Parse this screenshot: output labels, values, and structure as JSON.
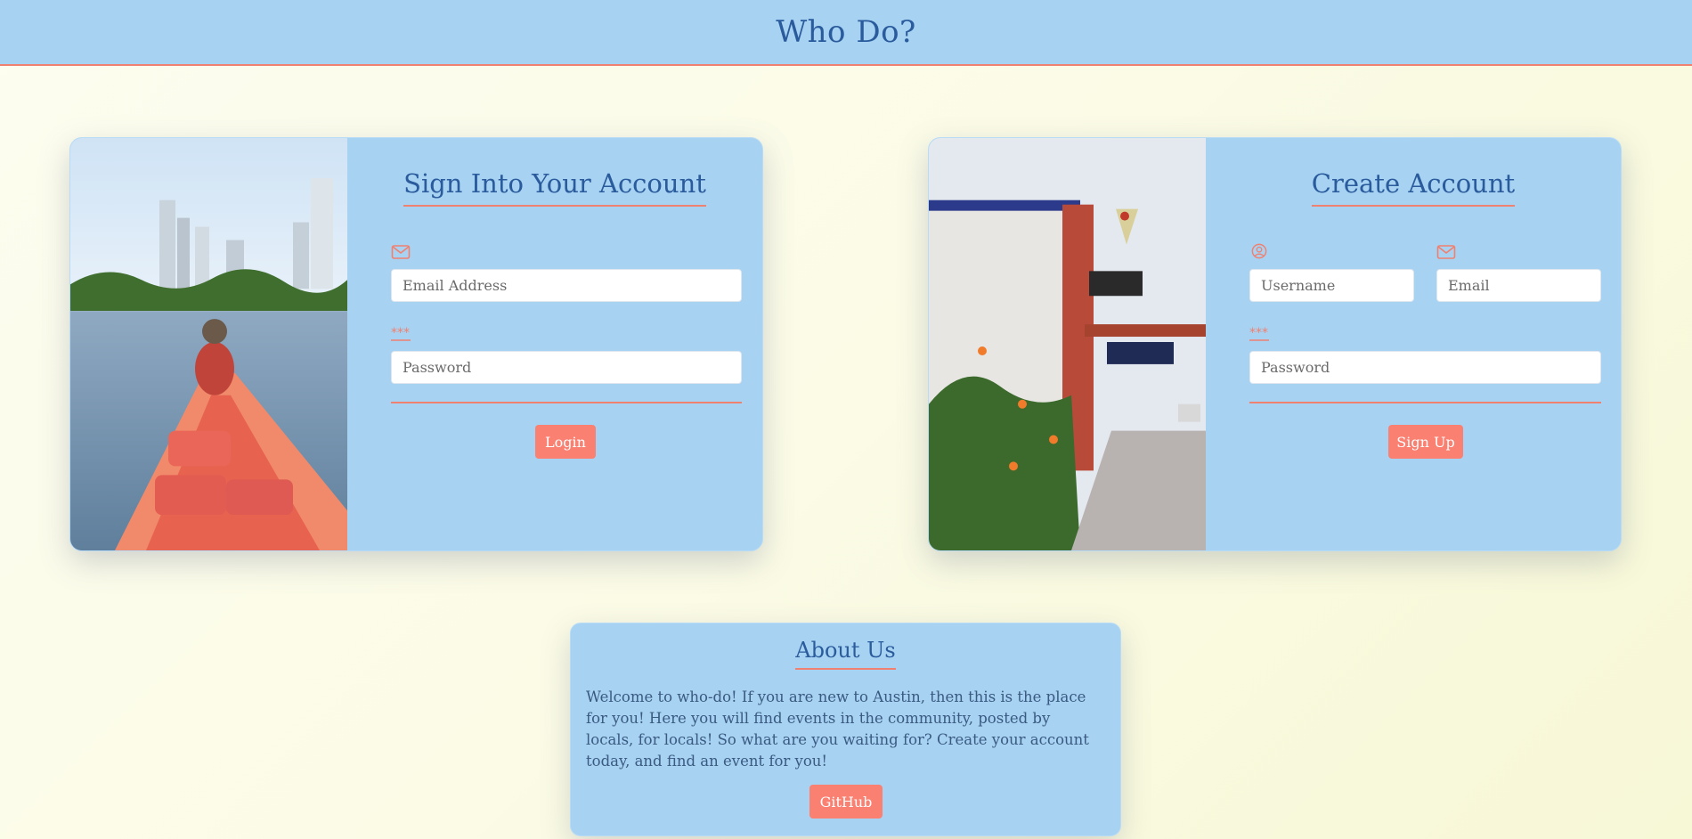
{
  "header": {
    "title": "Who Do?"
  },
  "login": {
    "title": "Sign Into Your Account",
    "email_placeholder": "Email Address",
    "password_placeholder": "Password",
    "button_label": "Login"
  },
  "signup": {
    "title": "Create Account",
    "username_placeholder": "Username",
    "email_placeholder": "Email",
    "password_placeholder": "Password",
    "button_label": "Sign Up"
  },
  "about": {
    "title": "About Us",
    "text": "Welcome to who-do! If you are new to Austin, then this is the place for you! Here you will find events in the community, posted by locals, for locals! So what are you waiting for? Create your account today, and find an event for you!",
    "button_label": "GitHub"
  },
  "colors": {
    "header_bg": "#a7d2f2",
    "accent": "#fa8072",
    "title_text": "#2a5b9c",
    "page_bg": "#fbfbe6"
  },
  "icons": {
    "email": "envelope-icon",
    "password": "asterisks-icon",
    "username": "user-circle-icon"
  }
}
